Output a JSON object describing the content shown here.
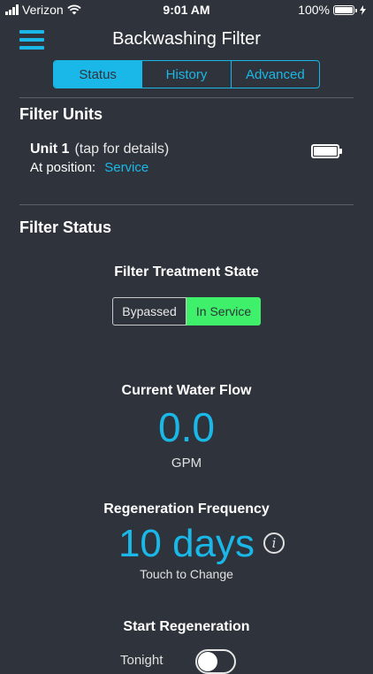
{
  "status_bar": {
    "carrier": "Verizon",
    "time": "9:01 AM",
    "battery_percent": "100%"
  },
  "header": {
    "title": "Backwashing Filter",
    "menu_icon": "hamburger-menu-icon"
  },
  "tabs": [
    {
      "label": "Status",
      "active": true
    },
    {
      "label": "History",
      "active": false
    },
    {
      "label": "Advanced",
      "active": false
    }
  ],
  "filter_units": {
    "title": "Filter Units",
    "unit_name": "Unit 1",
    "unit_hint": "(tap for details)",
    "position_label": "At position:",
    "position_value": "Service",
    "battery_icon": "battery-full-icon"
  },
  "filter_status": {
    "title": "Filter Status",
    "treatment_state_label": "Filter Treatment State",
    "state_options": [
      "Bypassed",
      "In Service"
    ],
    "selected_state": "In Service",
    "flow_label": "Current Water Flow",
    "flow_value": "0.0",
    "flow_unit": "GPM",
    "regen_label": "Regeneration Frequency",
    "regen_value": "10 days",
    "regen_hint": "Touch to Change",
    "start_regen_label": "Start Regeneration",
    "tonight_label": "Tonight",
    "tonight_on": false
  },
  "colors": {
    "background": "#2f343c",
    "accent": "#1ab8e8",
    "active_state": "#3ef06a"
  }
}
